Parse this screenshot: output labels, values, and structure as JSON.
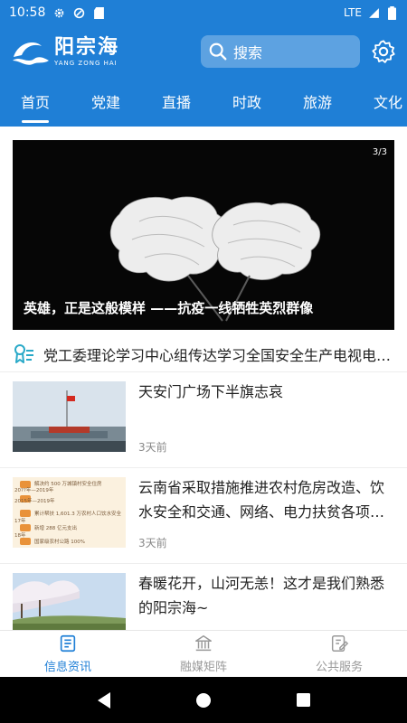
{
  "status_bar": {
    "time": "10:58",
    "network": "LTE"
  },
  "header": {
    "logo_cn": "阳宗海",
    "logo_en": "YANG ZONG HAI",
    "search_placeholder": "搜索"
  },
  "tabs": [
    {
      "label": "首页",
      "active": true
    },
    {
      "label": "党建",
      "active": false
    },
    {
      "label": "直播",
      "active": false
    },
    {
      "label": "时政",
      "active": false
    },
    {
      "label": "旅游",
      "active": false
    },
    {
      "label": "文化",
      "active": false
    }
  ],
  "banner": {
    "counter": "3/3",
    "caption": "英雄，正是这般模样 ——抗疫一线牺牲英烈群像"
  },
  "notice": {
    "text": "党工委理论学习中心组传达学习全国安全生产电视电…"
  },
  "news": [
    {
      "title": "天安门广场下半旗志哀",
      "time": "3天前"
    },
    {
      "title": "云南省采取措施推进农村危房改造、饮水安全和交通、网络、电力扶贫各项…",
      "time": "3天前"
    },
    {
      "title": "春暖花开，山河无恙！这才是我们熟悉的阳宗海~",
      "time": ""
    }
  ],
  "thumb2_lines": [
    "解决约 500 万城镇村安全住房",
    "20??年—2019年",
    "2015年—2019年",
    "累计帮扶 1,601.3 万农村人口饮水安全",
    "17年",
    "新增 288 亿元支出",
    "18年",
    "国家级农村公路 100%"
  ],
  "bottom_nav": [
    {
      "label": "信息资讯",
      "active": true
    },
    {
      "label": "融媒矩阵",
      "active": false
    },
    {
      "label": "公共服务",
      "active": false
    }
  ],
  "colors": {
    "brand": "#1f7fd6",
    "active_nav": "#1f7fd6"
  }
}
